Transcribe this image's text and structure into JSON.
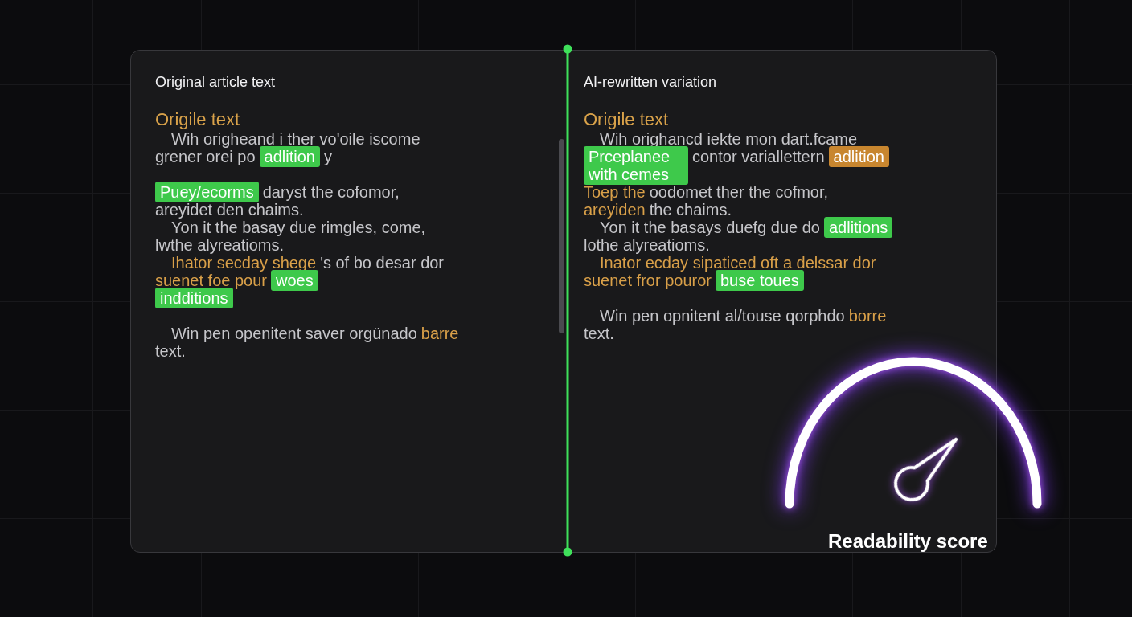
{
  "panels": [
    {
      "title": "Original article text",
      "subtitle": "Origile text",
      "scrollable": true,
      "paragraphs": [
        {
          "lines": [
            {
              "indent": true,
              "segments": [
                {
                  "kind": "plain",
                  "text": "Wih origheand i ther vo'oile iscome"
                }
              ]
            },
            {
              "indent": false,
              "segments": [
                {
                  "kind": "plain",
                  "text": "grener orei po"
                },
                {
                  "kind": "mark",
                  "text": "adlition"
                },
                {
                  "kind": "plain",
                  "text": "y"
                }
              ]
            }
          ]
        },
        {
          "lines": [
            {
              "indent": false,
              "segments": [
                {
                  "kind": "mark",
                  "text": "Puey/ecorms"
                },
                {
                  "kind": "plain",
                  "text": "daryst the cofomor,"
                }
              ]
            },
            {
              "indent": false,
              "segments": [
                {
                  "kind": "plain",
                  "text": "areyidet den chaims."
                }
              ]
            },
            {
              "indent": true,
              "segments": [
                {
                  "kind": "plain",
                  "text": "Yon it the basay due rimgles, come,"
                }
              ]
            },
            {
              "indent": false,
              "segments": [
                {
                  "kind": "plain",
                  "text": "lwthe alyreatioms."
                }
              ]
            },
            {
              "indent": true,
              "segments": [
                {
                  "kind": "accent",
                  "text": "Ihator secday shege"
                },
                {
                  "kind": "plain",
                  "text": "'s of bo desar dor"
                }
              ]
            },
            {
              "indent": false,
              "segments": [
                {
                  "kind": "accent",
                  "text": "suenet foe pour"
                },
                {
                  "kind": "mark",
                  "text": "woes"
                }
              ]
            },
            {
              "indent": false,
              "segments": [
                {
                  "kind": "mark",
                  "text": "indditions"
                }
              ]
            }
          ]
        },
        {
          "lines": [
            {
              "indent": true,
              "segments": [
                {
                  "kind": "plain",
                  "text": "Win pen openitent saver orgünado"
                },
                {
                  "kind": "accent",
                  "text": "barre"
                }
              ]
            },
            {
              "indent": false,
              "segments": [
                {
                  "kind": "plain",
                  "text": "text."
                }
              ]
            }
          ]
        }
      ]
    },
    {
      "title": "AI-rewritten variation",
      "subtitle": "Origile text",
      "scrollable": false,
      "paragraphs": [
        {
          "lines": [
            {
              "indent": true,
              "segments": [
                {
                  "kind": "plain",
                  "text": "Wih orighancd iekte mon dart.fcame"
                }
              ]
            },
            {
              "indent": false,
              "segments": [
                {
                  "kind": "mark",
                  "wrap": true,
                  "text": "Prceplanee with cemes"
                },
                {
                  "kind": "plain",
                  "text": "contor variallettern"
                },
                {
                  "kind": "mark_accent",
                  "text": "adlition"
                }
              ]
            },
            {
              "indent": false,
              "segments": [
                {
                  "kind": "accent",
                  "text": "Toep the"
                },
                {
                  "kind": "plain",
                  "text": "oodomet ther the cofmor,"
                }
              ]
            },
            {
              "indent": false,
              "segments": [
                {
                  "kind": "accent",
                  "text": "areyiden"
                },
                {
                  "kind": "plain",
                  "text": "the chaims."
                }
              ]
            },
            {
              "indent": true,
              "segments": [
                {
                  "kind": "plain",
                  "text": "Yon it the basays duefg due do"
                },
                {
                  "kind": "mark",
                  "text": "adlitions"
                }
              ]
            },
            {
              "indent": false,
              "segments": [
                {
                  "kind": "plain",
                  "text": "lothe alyreatioms."
                }
              ]
            },
            {
              "indent": true,
              "segments": [
                {
                  "kind": "accent",
                  "text": "Inator ecday sipaticed oft a delssar dor"
                }
              ]
            },
            {
              "indent": false,
              "segments": [
                {
                  "kind": "accent",
                  "text": "suenet fror pouror"
                },
                {
                  "kind": "mark",
                  "text": "buse toues"
                }
              ]
            }
          ]
        },
        {
          "lines": [
            {
              "indent": true,
              "segments": [
                {
                  "kind": "plain",
                  "text": "Win pen opnitent al/touse qorphdo"
                },
                {
                  "kind": "accent",
                  "text": "borre"
                }
              ]
            },
            {
              "indent": false,
              "segments": [
                {
                  "kind": "plain",
                  "text": "text."
                }
              ]
            }
          ]
        }
      ]
    }
  ],
  "gauge": {
    "label": "Readability score"
  }
}
